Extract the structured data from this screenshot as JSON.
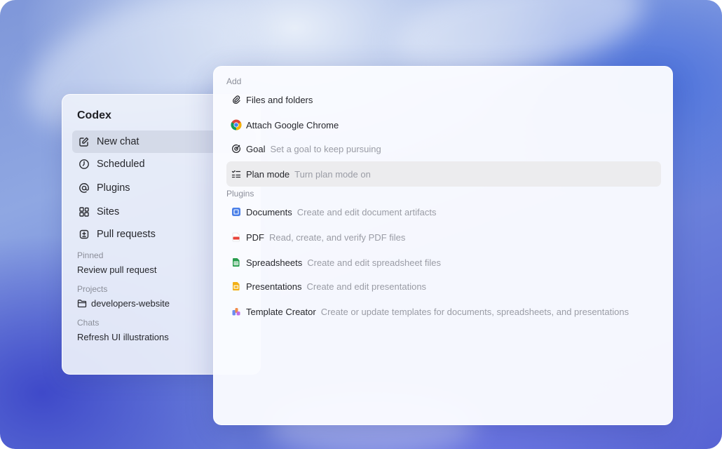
{
  "sidebar": {
    "title": "Codex",
    "nav": [
      {
        "label": "New chat",
        "icon": "edit-icon",
        "active": true
      },
      {
        "label": "Scheduled",
        "icon": "clock-icon"
      },
      {
        "label": "Plugins",
        "icon": "at-icon"
      },
      {
        "label": "Sites",
        "icon": "sites-grid-icon"
      },
      {
        "label": "Pull requests",
        "icon": "pull-request-icon"
      }
    ],
    "pinned": {
      "label": "Pinned",
      "item": "Review pull request"
    },
    "projects": {
      "label": "Projects",
      "item": "developers-website"
    },
    "chats": {
      "label": "Chats",
      "item": "Refresh UI illustrations"
    }
  },
  "menu": {
    "add_label": "Add",
    "add_items": [
      {
        "name": "Files and folders",
        "desc": "",
        "icon": "paperclip-icon"
      },
      {
        "name": "Attach Google Chrome",
        "desc": "",
        "icon": "chrome-icon"
      },
      {
        "name": "Goal",
        "desc": "Set a goal to keep pursuing",
        "icon": "goal-icon"
      },
      {
        "name": "Plan mode",
        "desc": "Turn plan mode on",
        "icon": "checklist-icon",
        "highlighted": true
      }
    ],
    "plugins_label": "Plugins",
    "plugin_items": [
      {
        "name": "Documents",
        "desc": "Create and edit document artifacts",
        "icon": "docs-icon"
      },
      {
        "name": "PDF",
        "desc": "Read, create, and verify PDF files",
        "icon": "pdf-icon"
      },
      {
        "name": "Spreadsheets",
        "desc": "Create and edit spreadsheet files",
        "icon": "sheets-icon"
      },
      {
        "name": "Presentations",
        "desc": "Create and edit presentations",
        "icon": "slides-icon"
      },
      {
        "name": "Template Creator",
        "desc": "Create or update templates for documents, spreadsheets, and presentations",
        "icon": "template-icon"
      }
    ]
  },
  "colors": {
    "docs": "#4a7fe8",
    "pdf": "#e8433a",
    "sheets": "#2a9d4e",
    "slides": "#f2b015",
    "highlight": "#ececee"
  }
}
